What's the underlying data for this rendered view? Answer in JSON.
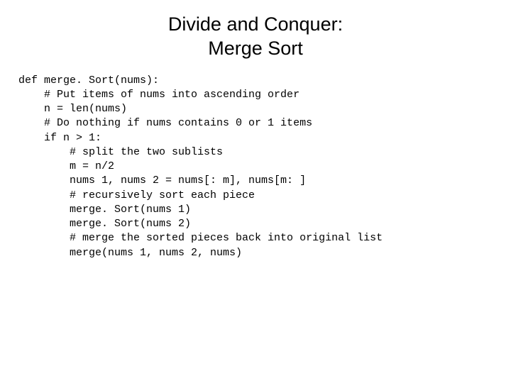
{
  "title_line1": "Divide and Conquer:",
  "title_line2": "Merge Sort",
  "code": {
    "l1": "def merge. Sort(nums):",
    "l2": "    # Put items of nums into ascending order",
    "l3": "    n = len(nums)",
    "l4": "    # Do nothing if nums contains 0 or 1 items",
    "l5": "    if n > 1:",
    "l6": "        # split the two sublists",
    "l7": "        m = n/2",
    "l8": "        nums 1, nums 2 = nums[: m], nums[m: ]",
    "l9": "        # recursively sort each piece",
    "l10": "        merge. Sort(nums 1)",
    "l11": "        merge. Sort(nums 2)",
    "l12": "        # merge the sorted pieces back into original list",
    "l13": "        merge(nums 1, nums 2, nums)"
  }
}
